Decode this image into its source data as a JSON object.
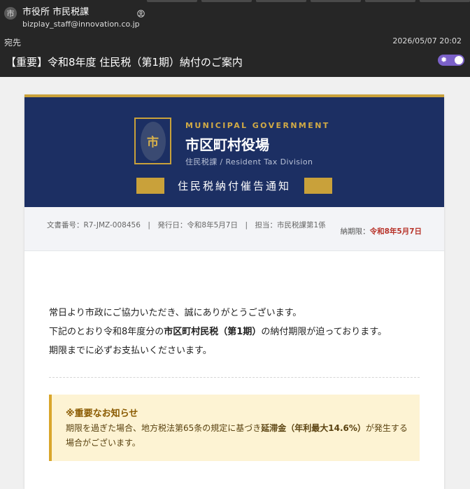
{
  "email": {
    "avatar_char": "市",
    "sender_name": "市役所 市民税課",
    "sender_email": "bizplay_staff@innovation.co.jp",
    "to_label": "宛先",
    "date": "2026/05/07 20:02",
    "subject": "【重要】令和8年度 住民税（第1期）納付のご案内"
  },
  "banner": {
    "emblem_char": "市",
    "gov_en": "MUNICIPAL GOVERNMENT",
    "gov_ja": "市区町村役場",
    "division": "住民税課 / Resident Tax Division",
    "notice_title": "住民税納付催告通知"
  },
  "meta": {
    "info": "文書番号：R7-JMZ-008456　|　発行日：令和8年5月7日　|　担当：市民税課第1係",
    "deadline_label": "納期限：",
    "deadline_value": "令和8年5月7日"
  },
  "body": {
    "line1": "常日より市政にご協力いただき、誠にありがとうございます。",
    "line2_pre": "下記のとおり令和8年度分の",
    "line2_bold": "市区町村民税（第1期）",
    "line2_post": "の納付期限が迫っております。",
    "line3": "期限までに必ずお支払いくださいます。"
  },
  "alert": {
    "title": "※重要なお知らせ",
    "text_pre": "期限を過ぎた場合、地方税法第65条の規定に基づき",
    "text_bold": "延滞金（年利最大14.6%）",
    "text_post": "が発生する場合がございます。"
  },
  "colors": {
    "banner_navy": "#1c2f63",
    "gold": "#c9a13a",
    "deadline_red": "#b8342b",
    "alert_bg": "#fdf3d3",
    "toggle_purple": "#7b61c9"
  }
}
